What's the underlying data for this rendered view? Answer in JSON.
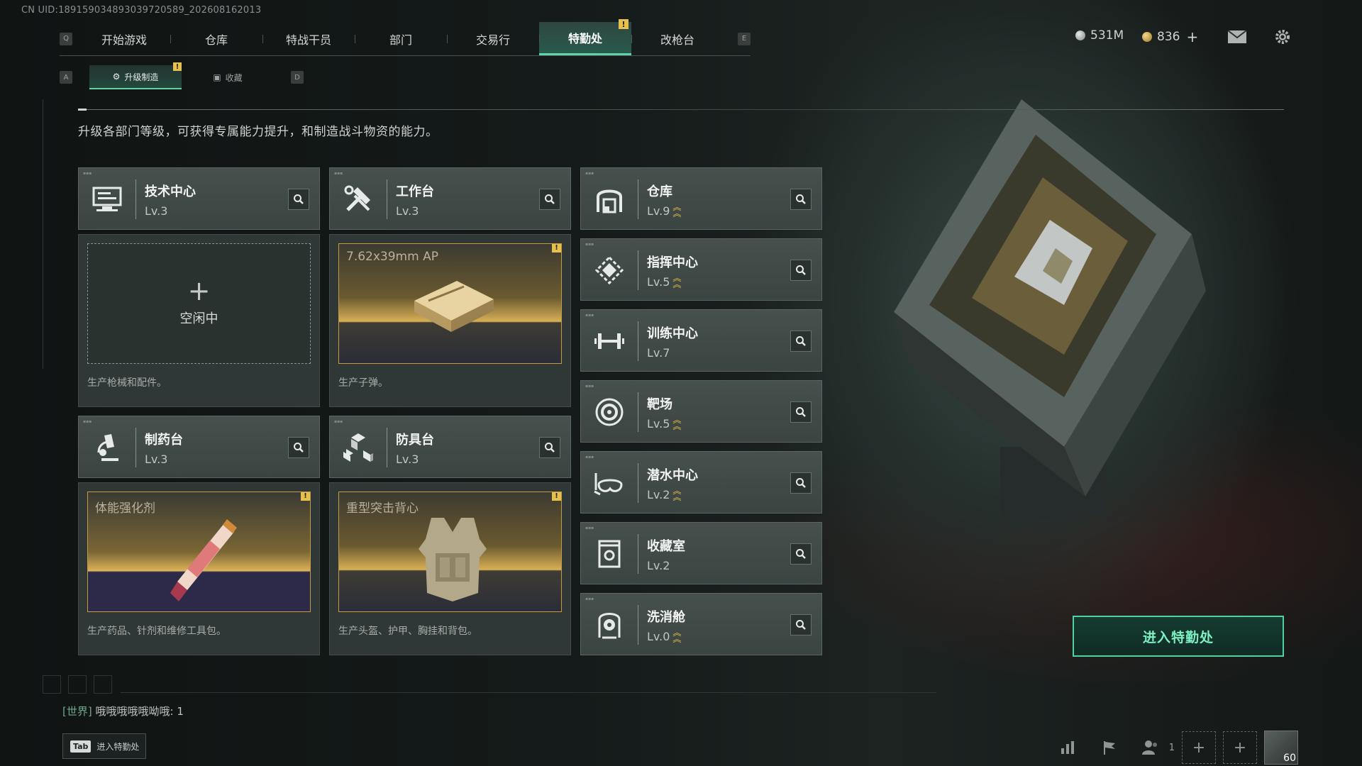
{
  "uid": "CN UID:189159034893039720589_202608162013",
  "nav": {
    "key_left": "Q",
    "key_right": "E",
    "tabs": [
      "开始游戏",
      "仓库",
      "特战干员",
      "部门",
      "交易行",
      "特勤处",
      "改枪台"
    ],
    "active_index": 5
  },
  "currency": {
    "silver": "531M",
    "gold": "836"
  },
  "subnav": {
    "key_left": "A",
    "key_right": "D",
    "tabs": [
      "升级制造",
      "收藏"
    ]
  },
  "description": "升级各部门等级，可获得专属能力提升，和制造战斗物资的能力。",
  "craft_modules": [
    {
      "name": "技术中心",
      "level": "Lv.3",
      "icon": "computer-icon",
      "slot_state": "empty",
      "slot_text": "空闲中",
      "note": "生产枪械和配件。"
    },
    {
      "name": "工作台",
      "level": "Lv.3",
      "icon": "tools-icon",
      "slot_state": "crafting",
      "slot_text": "7.62x39mm AP",
      "note": "生产子弹。"
    },
    {
      "name": "制药台",
      "level": "Lv.3",
      "icon": "microscope-icon",
      "slot_state": "crafting",
      "slot_text": "体能强化剂",
      "note": "生产药品、针剂和维修工具包。"
    },
    {
      "name": "防具台",
      "level": "Lv.3",
      "icon": "cubes-icon",
      "slot_state": "crafting",
      "slot_text": "重型突击背心",
      "note": "生产头盔、护甲、胸挂和背包。"
    }
  ],
  "facilities": [
    {
      "name": "仓库",
      "level": "Lv.9",
      "upgradable": true,
      "icon": "storage-icon"
    },
    {
      "name": "指挥中心",
      "level": "Lv.5",
      "upgradable": true,
      "icon": "command-icon"
    },
    {
      "name": "训练中心",
      "level": "Lv.7",
      "upgradable": false,
      "icon": "dumbbell-icon"
    },
    {
      "name": "靶场",
      "level": "Lv.5",
      "upgradable": true,
      "icon": "target-icon"
    },
    {
      "name": "潜水中心",
      "level": "Lv.2",
      "upgradable": true,
      "icon": "diving-mask-icon"
    },
    {
      "name": "收藏室",
      "level": "Lv.2",
      "upgradable": false,
      "icon": "collection-icon"
    },
    {
      "name": "洗消舱",
      "level": "Lv.0",
      "upgradable": true,
      "icon": "decontamination-icon"
    }
  ],
  "enter_button": "进入特勤处",
  "chat": {
    "channel": "[世界]",
    "message": "哦哦哦哦哦呦哦: 1"
  },
  "tab_hint": {
    "key": "Tab",
    "label": "进入特勤处"
  },
  "bottom": {
    "squad_count": "1",
    "avatar_level": "60"
  },
  "colors": {
    "accent": "#5fd3a8",
    "warning": "#e5c04c",
    "card_bg": "#434d4a"
  }
}
